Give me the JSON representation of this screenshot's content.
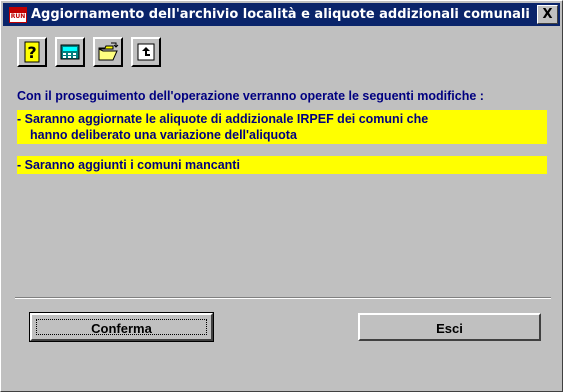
{
  "window": {
    "app_icon": "RUN",
    "title": "Aggiornamento dell'archivio località e aliquote addizionali comunali",
    "close_label": "X"
  },
  "toolbar": {
    "buttons": [
      {
        "icon": "help-icon"
      },
      {
        "icon": "calculator-icon"
      },
      {
        "icon": "open-folder-icon"
      },
      {
        "icon": "import-icon"
      }
    ]
  },
  "content": {
    "intro": "Con il proseguimento dell'operazione verranno operate le seguenti modifiche :",
    "note1_line1": "- Saranno aggiornate le aliquote di addizionale IRPEF dei comuni che",
    "note1_line2": "hanno deliberato una variazione dell'aliquota",
    "note2": "- Saranno aggiunti i comuni mancanti"
  },
  "buttons": {
    "confirm": "Conferma",
    "exit": "Esci"
  },
  "colors": {
    "titlebar": "#0a246a",
    "face": "#c0c0c0",
    "text": "#000080",
    "highlight": "#ffff00"
  }
}
